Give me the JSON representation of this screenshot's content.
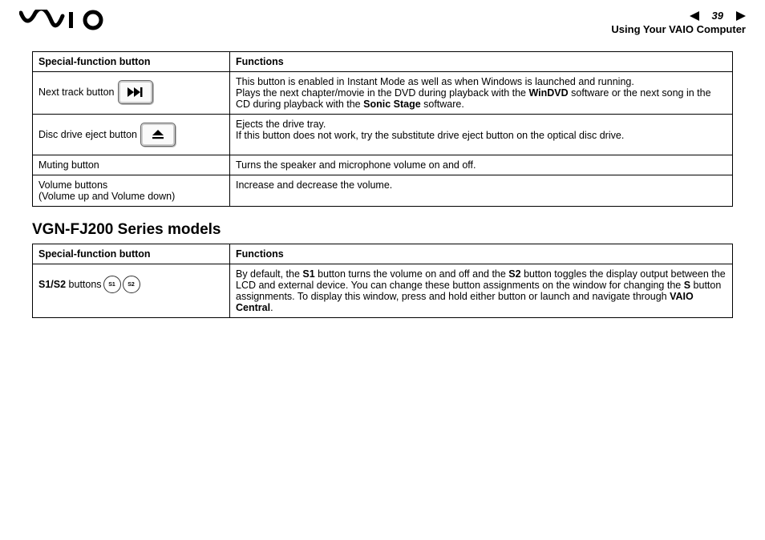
{
  "header": {
    "page_number": "39",
    "section": "Using Your VAIO Computer"
  },
  "table1": {
    "head_btn": "Special-function button",
    "head_fn": "Functions",
    "rows": [
      {
        "label": "Next track button",
        "fn_line1": "This button is enabled in Instant Mode as well as when Windows is launched and running.",
        "fn_line2a": "Plays the next chapter/movie in the DVD during playback with the ",
        "fn_line2_bold1": "WinDVD",
        "fn_line2b": " software or the next song in the CD during playback with the ",
        "fn_line2_bold2": "Sonic Stage",
        "fn_line2c": " software."
      },
      {
        "label": "Disc drive eject button",
        "fn_line1": "Ejects the drive tray.",
        "fn_line2": "If this button does not work, try the substitute drive eject button on the optical disc drive."
      },
      {
        "label": "Muting button",
        "fn": "Turns the speaker and microphone volume on and off."
      },
      {
        "label_line1": "Volume buttons",
        "label_line2": "(Volume up and Volume down)",
        "fn": "Increase and decrease the volume."
      }
    ]
  },
  "series_heading": "VGN-FJ200 Series models",
  "table2": {
    "head_btn": "Special-function button",
    "head_fn": "Functions",
    "row": {
      "label_bold": "S1/S2",
      "label_rest": " buttons",
      "s1": "S1",
      "s2": "S2",
      "fn_a": "By default, the ",
      "fn_b1": "S1",
      "fn_b": " button turns the volume on and off and the ",
      "fn_b2": "S2",
      "fn_c": " button toggles the display output between the LCD and external device. You can change these button assignments on the window for changing the ",
      "fn_b3": "S",
      "fn_d": " button assignments. To display this window, press and hold either button or launch and navigate through ",
      "fn_b4": "VAIO Central",
      "fn_e": "."
    }
  }
}
